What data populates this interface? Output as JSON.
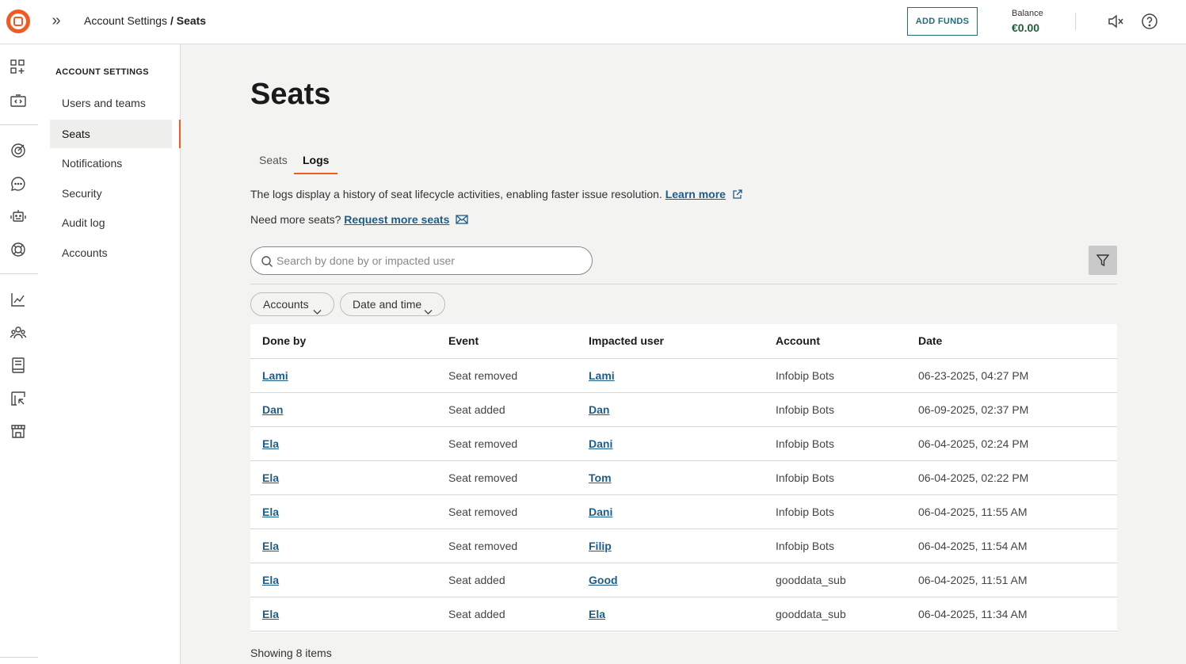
{
  "header": {
    "breadcrumb_parent": "Account Settings",
    "breadcrumb_sep": " / ",
    "breadcrumb_current": "Seats",
    "add_funds_label": "ADD FUNDS",
    "balance_label": "Balance",
    "balance_value": "€0.00",
    "icons": [
      "expand-icon",
      "mute-icon",
      "help-icon"
    ]
  },
  "rail": {
    "icons": [
      "apps-add-icon",
      "developer-tools-icon",
      "target-icon",
      "chat-icon",
      "bot-icon",
      "ai-icon",
      "analytics-icon",
      "people-icon",
      "docs-icon",
      "campaign-icon",
      "store-icon"
    ]
  },
  "sidenav": {
    "title": "ACCOUNT SETTINGS",
    "items": [
      {
        "label": "Users and teams"
      },
      {
        "label": "Seats"
      },
      {
        "label": "Notifications"
      },
      {
        "label": "Security"
      },
      {
        "label": "Audit log"
      },
      {
        "label": "Accounts"
      }
    ],
    "active": "Seats"
  },
  "main": {
    "title": "Seats",
    "tabs": [
      {
        "label": "Seats"
      },
      {
        "label": "Logs"
      }
    ],
    "active_tab": "Logs",
    "info_text": "The logs display a history of seat lifecycle activities, enabling faster issue resolution. ",
    "learn_more": "Learn more",
    "need_more": "Need more seats? ",
    "request_link": "Request more seats",
    "search_placeholder": "Search by done by or impacted user",
    "filters": [
      {
        "label": "Accounts"
      },
      {
        "label": "Date and time"
      }
    ],
    "table": {
      "columns": [
        "Done by",
        "Event",
        "Impacted user",
        "Account",
        "Date"
      ],
      "rows": [
        [
          "Lami",
          "Seat removed",
          "Lami",
          "Infobip Bots",
          "06-23-2025, 04:27 PM"
        ],
        [
          "Dan",
          "Seat added",
          "Dan",
          "Infobip Bots",
          "06-09-2025, 02:37 PM"
        ],
        [
          "Ela",
          "Seat removed",
          "Dani",
          "Infobip Bots",
          "06-04-2025, 02:24 PM"
        ],
        [
          "Ela",
          "Seat removed",
          "Tom",
          "Infobip Bots",
          "06-04-2025, 02:22 PM"
        ],
        [
          "Ela",
          "Seat removed",
          "Dani",
          "Infobip Bots",
          "06-04-2025, 11:55 AM"
        ],
        [
          "Ela",
          "Seat removed",
          "Filip",
          "Infobip Bots",
          "06-04-2025, 11:54 AM"
        ],
        [
          "Ela",
          "Seat added",
          "Good",
          "gooddata_sub",
          "06-04-2025, 11:51 AM"
        ],
        [
          "Ela",
          "Seat added",
          "Ela",
          "gooddata_sub",
          "06-04-2025, 11:34 AM"
        ]
      ]
    },
    "showing": "Showing 8 items"
  },
  "colors": {
    "accent": "#f15a22",
    "link": "#1d5d8a",
    "button_border": "#1d6f78",
    "balance": "#1d5f3a"
  }
}
